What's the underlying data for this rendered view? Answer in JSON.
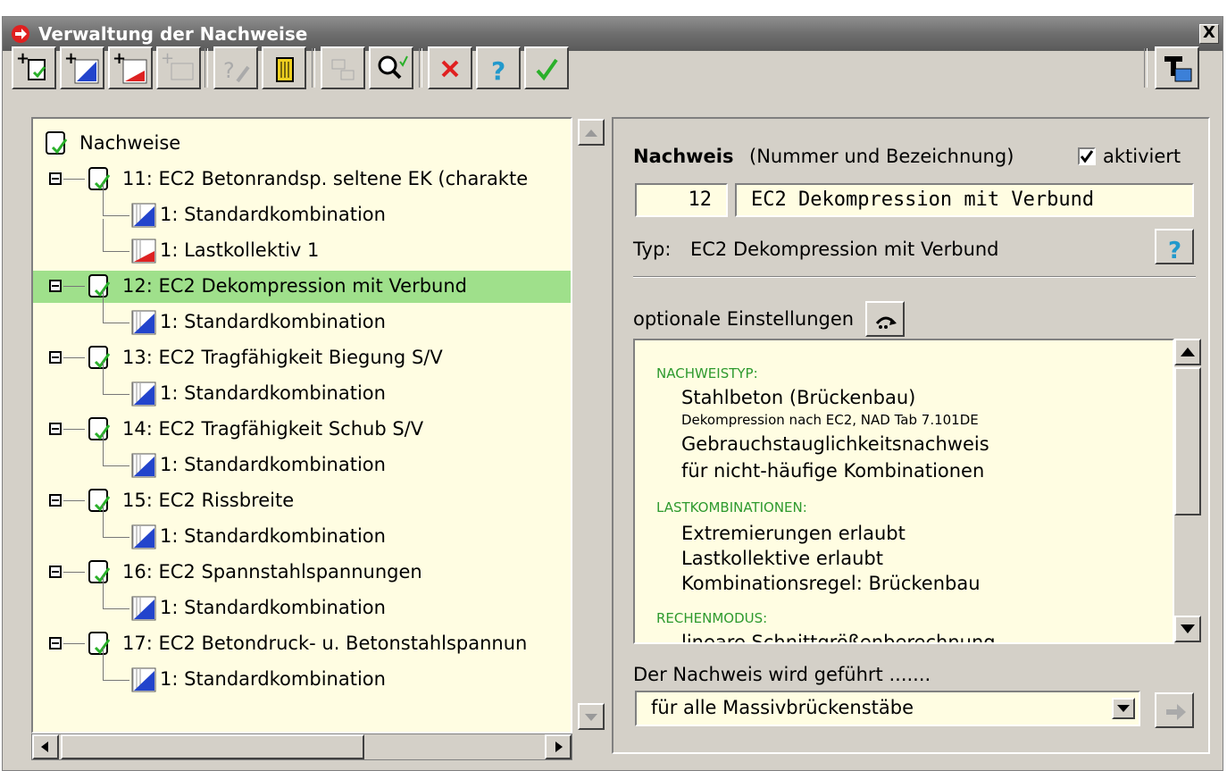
{
  "window": {
    "title": "Verwaltung der Nachweise",
    "close": "X"
  },
  "toolbar": {
    "buttons": [
      {
        "name": "add-nachweis-button",
        "enabled": true
      },
      {
        "name": "add-standardkombination-button",
        "enabled": true
      },
      {
        "name": "add-lastkollektiv-button",
        "enabled": true
      },
      {
        "name": "add-special-button",
        "enabled": false
      },
      {
        "name": "edit-button",
        "enabled": false
      },
      {
        "name": "delete-button",
        "enabled": true
      },
      {
        "name": "flowchart-button",
        "enabled": false
      },
      {
        "name": "check-button",
        "enabled": true
      },
      {
        "name": "cancel-button",
        "enabled": true
      },
      {
        "name": "help-button",
        "enabled": true
      },
      {
        "name": "ok-button",
        "enabled": true
      },
      {
        "name": "print-button",
        "enabled": true
      }
    ]
  },
  "tree": {
    "root": "Nachweise",
    "items": [
      {
        "label": "11: EC2 Betonrandsp. seltene EK (charakte",
        "children": [
          {
            "label": "1: Standardkombination",
            "kind": "kombi"
          },
          {
            "label": "1: Lastkollektiv 1",
            "kind": "kollektiv"
          }
        ]
      },
      {
        "label": "12: EC2 Dekompression mit Verbund",
        "selected": true,
        "children": [
          {
            "label": "1: Standardkombination",
            "kind": "kombi"
          }
        ]
      },
      {
        "label": "13: EC2 Tragfähigkeit Biegung S/V",
        "children": [
          {
            "label": "1: Standardkombination",
            "kind": "kombi"
          }
        ]
      },
      {
        "label": "14: EC2 Tragfähigkeit Schub S/V",
        "children": [
          {
            "label": "1: Standardkombination",
            "kind": "kombi"
          }
        ]
      },
      {
        "label": "15: EC2 Rissbreite",
        "children": [
          {
            "label": "1: Standardkombination",
            "kind": "kombi"
          }
        ]
      },
      {
        "label": "16: EC2 Spannstahlspannungen",
        "children": [
          {
            "label": "1: Standardkombination",
            "kind": "kombi"
          }
        ]
      },
      {
        "label": "17: EC2 Betondruck- u. Betonstahlspannun",
        "children": [
          {
            "label": "1: Standardkombination",
            "kind": "kombi"
          }
        ]
      }
    ]
  },
  "detail": {
    "nachweis_label": "Nachweis",
    "nachweis_hint": "(Nummer und Bezeichnung)",
    "aktiviert_label": "aktiviert",
    "aktiviert_checked": true,
    "number": "12",
    "name": "EC2 Dekompression mit Verbund",
    "typ_label": "Typ:",
    "typ_value": "EC2 Dekompression mit Verbund",
    "optionale_label": "optionale Einstellungen",
    "options": {
      "sec1": "NACHWEISTYP:",
      "sec1_l1": "Stahlbeton (Brückenbau)",
      "sec1_l2": "Dekompression nach EC2, NAD Tab 7.101DE",
      "sec1_l3": "Gebrauchstauglichkeitsnachweis",
      "sec1_l4": "für nicht-häufige Kombinationen",
      "sec2": "LASTKOMBINATIONEN:",
      "sec2_l1": "Extremierungen erlaubt",
      "sec2_l2": "Lastkollektive erlaubt",
      "sec2_l3": "Kombinationsregel: Brückenbau",
      "sec3": "RECHENMODUS:",
      "sec3_l1": "lineare Schnittgrößenberechnung"
    },
    "gefuehrt_label": "Der Nachweis wird geführt .......",
    "gefuehrt_value": "für alle Massivbrückenstäbe"
  }
}
